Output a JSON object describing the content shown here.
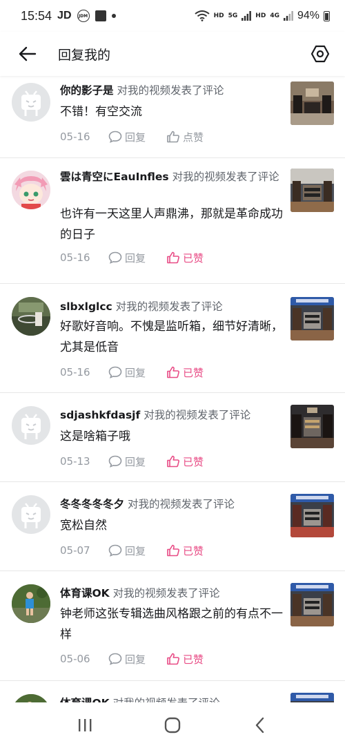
{
  "status_bar": {
    "time": "15:54",
    "carrier": "JD",
    "network_label": "HD",
    "network_label_2": "5G",
    "network_label_3": "HD",
    "network_label_4": "4G",
    "battery": "94%"
  },
  "header": {
    "title": "回复我的"
  },
  "comments": [
    {
      "username": "你的影子是",
      "action": "对我的视频发表了评论",
      "text": "不错！有空交流",
      "date": "05-16",
      "reply_label": "回复",
      "like_label": "点赞",
      "liked": false,
      "avatar": "default"
    },
    {
      "username": "雲は青空にEauInfles",
      "action": "对我的视频发表了评论",
      "text": "也许有一天这里人声鼎沸，那就是革命成功的日子",
      "date": "05-16",
      "reply_label": "回复",
      "like_label": "已赞",
      "liked": true,
      "avatar": "anime"
    },
    {
      "username": "slbxlglcc",
      "action": "对我的视频发表了评论",
      "text": "好歌好音响。不愧是监听箱，细节好清晰，尤其是低音",
      "date": "05-16",
      "reply_label": "回复",
      "like_label": "已赞",
      "liked": true,
      "avatar": "photo-green"
    },
    {
      "username": "sdjashkfdasjf",
      "action": "对我的视频发表了评论",
      "text": "这是啥箱子哦",
      "date": "05-13",
      "reply_label": "回复",
      "like_label": "已赞",
      "liked": true,
      "avatar": "default"
    },
    {
      "username": "冬冬冬冬冬夕",
      "action": "对我的视频发表了评论",
      "text": "宽松自然",
      "date": "05-07",
      "reply_label": "回复",
      "like_label": "已赞",
      "liked": true,
      "avatar": "default"
    },
    {
      "username": "体育课OK",
      "action": "对我的视频发表了评论",
      "text": "钟老师这张专辑选曲风格跟之前的有点不一样",
      "date": "05-06",
      "reply_label": "回复",
      "like_label": "已赞",
      "liked": true,
      "avatar": "photo-child"
    },
    {
      "username": "体育课OK",
      "action": "对我的视频发表了评论",
      "text": "",
      "date": "",
      "reply_label": "",
      "like_label": "",
      "liked": true,
      "avatar": "photo-child"
    }
  ],
  "colors": {
    "accent_pink": "#e84b85",
    "meta_gray": "#9499a0",
    "divider": "#e7e7e7"
  }
}
